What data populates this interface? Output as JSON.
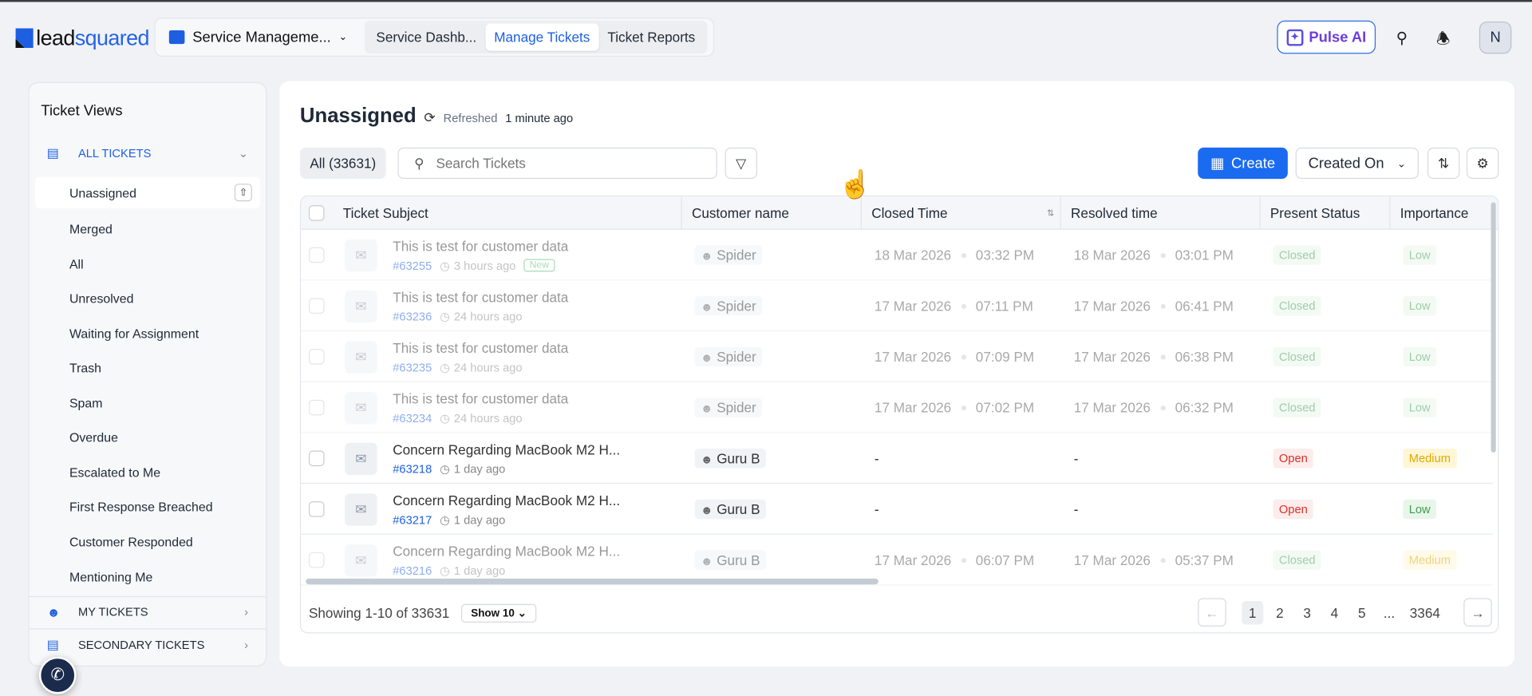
{
  "header": {
    "logo_a": "lead",
    "logo_b": "squared",
    "app": "Service Manageme...",
    "tabs": [
      {
        "label": "Service Dashb..."
      },
      {
        "label": "Manage Tickets"
      },
      {
        "label": "Ticket Reports"
      }
    ],
    "pulse": "Pulse AI",
    "avatar": "N"
  },
  "sidebar": {
    "title": "Ticket Views",
    "all_tickets": "ALL TICKETS",
    "items": [
      "Unassigned",
      "Merged",
      "All",
      "Unresolved",
      "Waiting for Assignment",
      "Trash",
      "Spam",
      "Overdue",
      "Escalated to Me",
      "First Response Breached",
      "Customer Responded",
      "Mentioning Me"
    ],
    "my_tickets": "MY TICKETS",
    "secondary": "SECONDARY TICKETS"
  },
  "main": {
    "title": "Unassigned",
    "refreshed": "Refreshed",
    "refreshed_time": "1 minute ago",
    "all_count": "All (33631)",
    "search_placeholder": "Search Tickets",
    "create": "Create",
    "sort": "Created On"
  },
  "table": {
    "columns": [
      "Ticket Subject",
      "Customer name",
      "Closed Time",
      "Resolved time",
      "Present Status",
      "Importance"
    ],
    "rows": [
      {
        "subject": "This is test for customer data",
        "id": "#63255",
        "age": "3 hours ago",
        "new": "New",
        "customer": "Spider",
        "closed_date": "18 Mar 2026",
        "closed_time": "03:32 PM",
        "resolved_date": "18 Mar 2026",
        "resolved_time": "03:01 PM",
        "status": "Closed",
        "importance": "Low",
        "faded": true
      },
      {
        "subject": "This is test for customer data",
        "id": "#63236",
        "age": "24 hours ago",
        "customer": "Spider",
        "closed_date": "17 Mar 2026",
        "closed_time": "07:11 PM",
        "resolved_date": "17 Mar 2026",
        "resolved_time": "06:41 PM",
        "status": "Closed",
        "importance": "Low",
        "faded": true
      },
      {
        "subject": "This is test for customer data",
        "id": "#63235",
        "age": "24 hours ago",
        "customer": "Spider",
        "closed_date": "17 Mar 2026",
        "closed_time": "07:09 PM",
        "resolved_date": "17 Mar 2026",
        "resolved_time": "06:38 PM",
        "status": "Closed",
        "importance": "Low",
        "faded": true
      },
      {
        "subject": "This is test for customer data",
        "id": "#63234",
        "age": "24 hours ago",
        "customer": "Spider",
        "closed_date": "17 Mar 2026",
        "closed_time": "07:02 PM",
        "resolved_date": "17 Mar 2026",
        "resolved_time": "06:32 PM",
        "status": "Closed",
        "importance": "Low",
        "faded": true
      },
      {
        "subject": "Concern Regarding MacBook M2 H...",
        "id": "#63218",
        "age": "1 day ago",
        "customer": "Guru B",
        "closed_empty": "-",
        "resolved_empty": "-",
        "status": "Open",
        "importance": "Medium",
        "faded": false
      },
      {
        "subject": "Concern Regarding MacBook M2 H...",
        "id": "#63217",
        "age": "1 day ago",
        "customer": "Guru B",
        "closed_empty": "-",
        "resolved_empty": "-",
        "status": "Open",
        "importance": "Low",
        "faded": false
      },
      {
        "subject": "Concern Regarding MacBook M2 H...",
        "id": "#63216",
        "age": "1 day ago",
        "customer": "Guru B",
        "closed_date": "17 Mar 2026",
        "closed_time": "06:07 PM",
        "resolved_date": "17 Mar 2026",
        "resolved_time": "05:37 PM",
        "status": "Closed",
        "importance": "Medium",
        "faded": true
      }
    ]
  },
  "footer": {
    "showing": "Showing 1-10 of 33631",
    "show": "Show 10",
    "pages": [
      "1",
      "2",
      "3",
      "4",
      "5",
      "...",
      "3364"
    ]
  },
  "colors": {
    "accent": "#1a6bf0",
    "closed": "#3f9c52",
    "open": "#d93025",
    "medium": "#e0a800",
    "low": "#3f9c52"
  }
}
